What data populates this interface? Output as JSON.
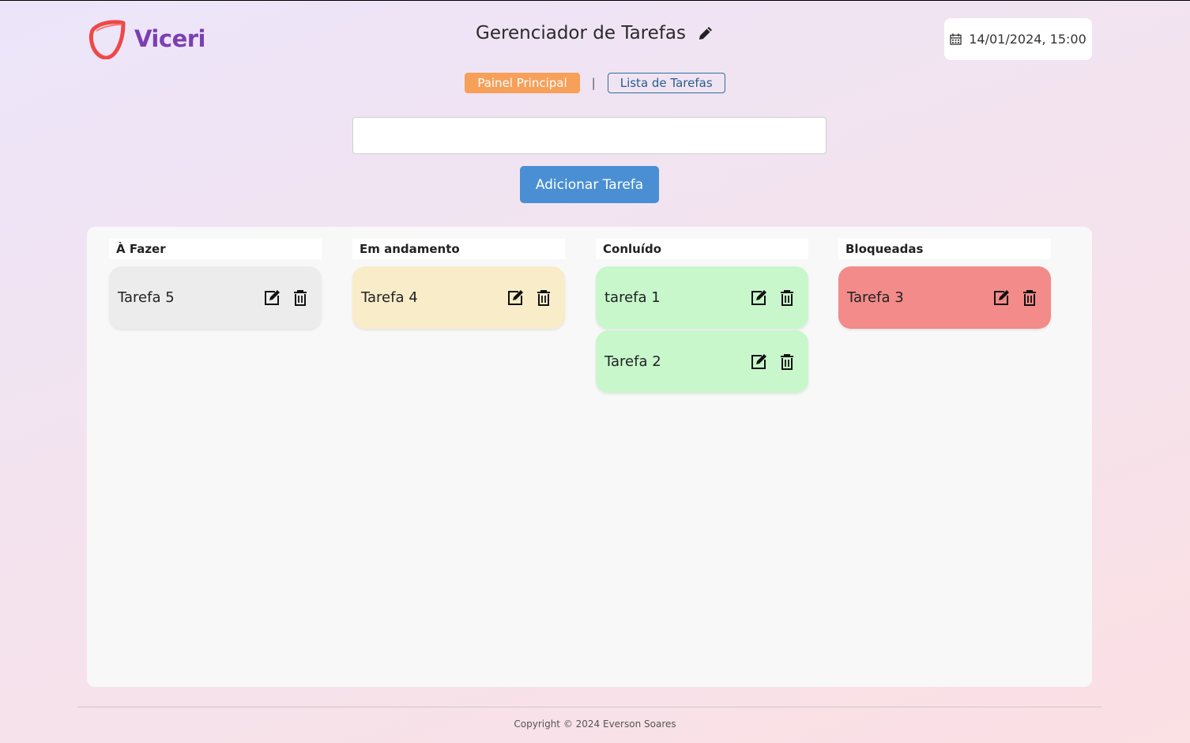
{
  "brand": {
    "name": "Viceri",
    "logo_color": "#ef4848",
    "text_color": "#7b3fb2"
  },
  "header": {
    "title": "Gerenciador de Tarefas",
    "title_icon": "pencil-icon",
    "datetime": "14/01/2024, 15:00",
    "date_icon": "calendar-icon"
  },
  "nav": {
    "main": "Painel Principal",
    "separator": "|",
    "list": "Lista de Tarefas"
  },
  "form": {
    "input_value": "",
    "placeholder": "",
    "add_label": "Adicionar Tarefa"
  },
  "columns": [
    {
      "title": "À Fazer",
      "color": "#ececec",
      "tasks": [
        "Tarefa 5"
      ]
    },
    {
      "title": "Em andamento",
      "color": "#f8ecc9",
      "tasks": [
        "Tarefa 4"
      ]
    },
    {
      "title": "Conluído",
      "color": "#c7f7cb",
      "tasks": [
        "tarefa 1",
        "Tarefa 2"
      ]
    },
    {
      "title": "Bloqueadas",
      "color": "#f28b89",
      "tasks": [
        "Tarefa 3"
      ]
    }
  ],
  "card_icons": [
    "edit-icon",
    "trash-icon"
  ],
  "footer": {
    "copyright": "Copyright © 2024 Everson Soares"
  }
}
